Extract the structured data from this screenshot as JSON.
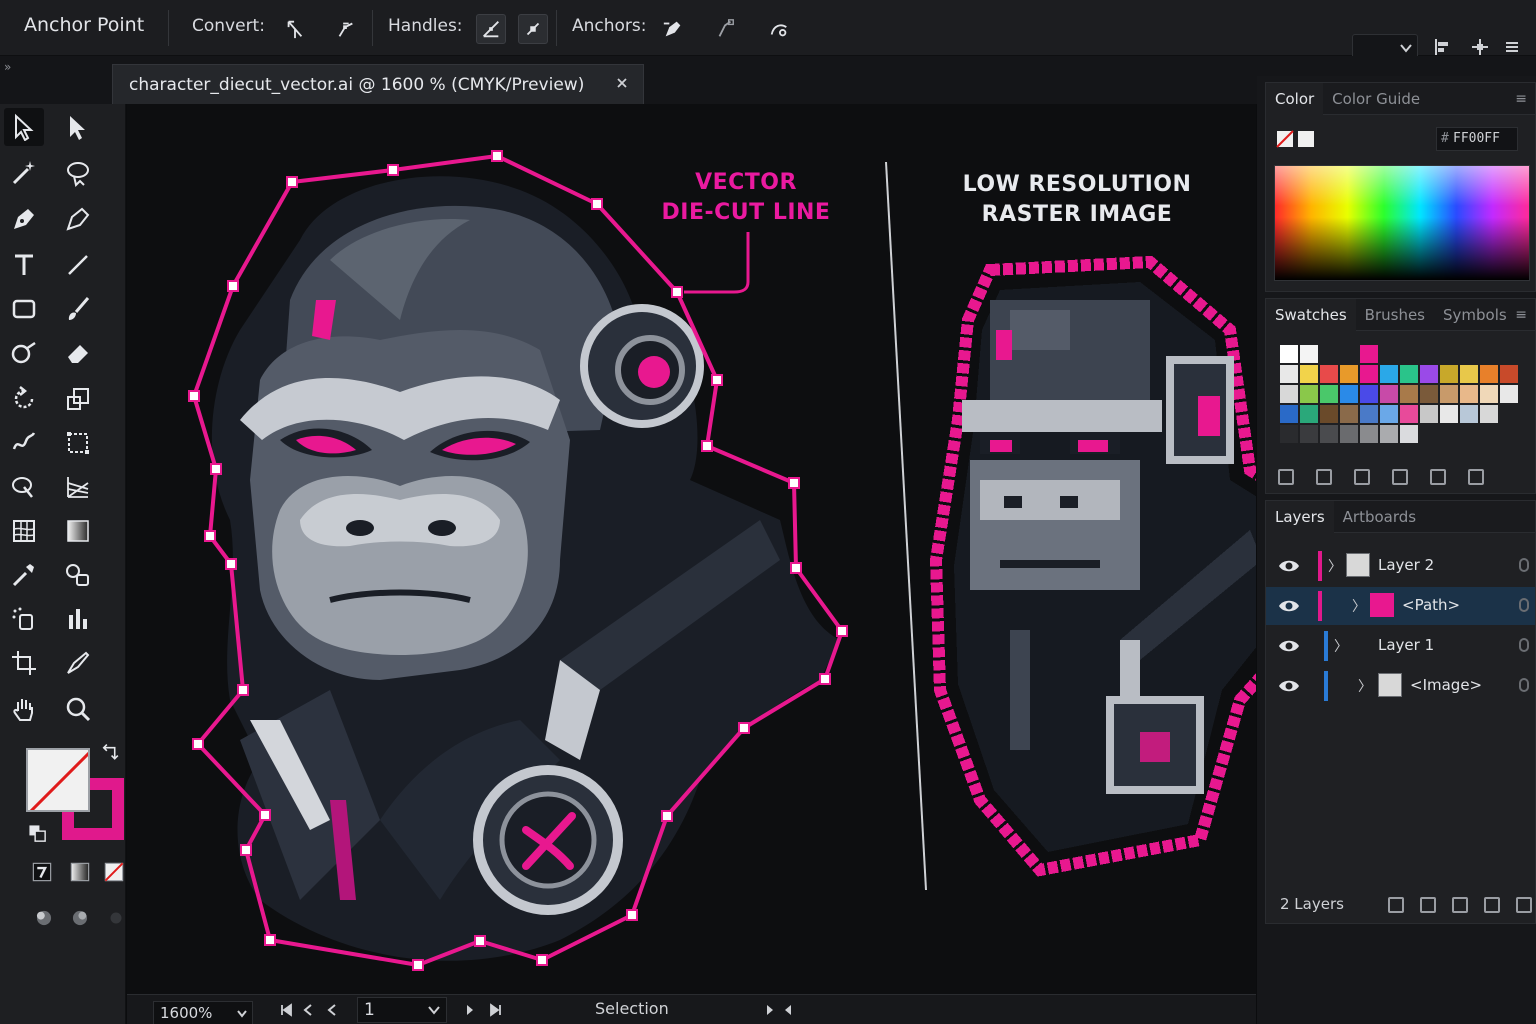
{
  "control_bar": {
    "title": "Anchor Point",
    "convert_label": "Convert:",
    "handles_label": "Handles:",
    "anchors_label": "Anchors:"
  },
  "document": {
    "tab_title": "character_diecut_vector.ai @ 1600 % (CMYK/Preview)"
  },
  "canvas": {
    "vector_callout": [
      "VECTOR",
      "DIE-CUT LINE"
    ],
    "raster_callout": [
      "LOW RESOLUTION",
      "RASTER IMAGE"
    ],
    "accent_color": "#E8188F"
  },
  "color_panel": {
    "tabs": [
      "Color",
      "Color Guide"
    ],
    "hex_value": "FF00FF"
  },
  "swatches_panel": {
    "tabs": [
      "Swatches",
      "Brushes",
      "Symbols"
    ]
  },
  "layers_panel": {
    "tabs": [
      "Layers",
      "Artboards"
    ],
    "layers": [
      {
        "name": "Layer 2",
        "color": "#e0198c"
      },
      {
        "name": "<Path>",
        "color": "#e0198c"
      },
      {
        "name": "Layer 1",
        "color": "#2a7bd6"
      },
      {
        "name": "<Image>",
        "color": "#2a7bd6"
      }
    ],
    "count_label": "2 Layers"
  },
  "status_bar": {
    "zoom": "1600%",
    "artboard": "1",
    "tool_status": "Selection"
  }
}
